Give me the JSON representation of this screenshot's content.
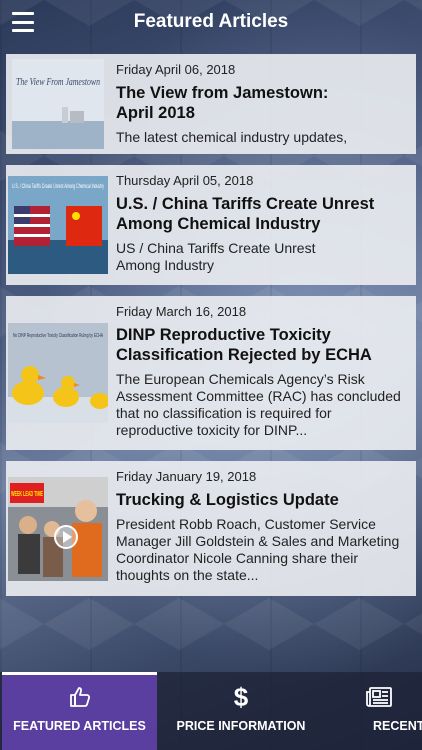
{
  "header": {
    "title": "Featured Articles",
    "menu_icon": "hamburger-menu-icon"
  },
  "articles": [
    {
      "date": "Friday April 06, 2018",
      "title": "The View from Jamestown: April 2018",
      "summary": "The latest chemical industry updates,",
      "thumb_text": "The View From Jamestown"
    },
    {
      "date": "Thursday April 05, 2018",
      "title": "U.S. / China Tariffs Create Unrest Among Chemical Industry",
      "summary": "US / China Tariffs Create Unrest Among Industry",
      "thumb_text": "U.S. / China Tariffs Create Unrest Among Chemical Industry"
    },
    {
      "date": "Friday March 16, 2018",
      "title": "DINP Reproductive Toxicity Classification Rejected by ECHA",
      "summary": "The European Chemicals Agency’s Risk Assessment Committee (RAC) has concluded that no classification is required for reproductive toxicity for DINP...",
      "thumb_text": "No DINP Reproductive Toxicity Classification Ruling by ECHA"
    },
    {
      "date": "Friday January 19, 2018",
      "title": "Trucking & Logistics Update",
      "summary": "President Robb Roach, Customer Service Manager Jill Goldstein & Sales and Marketing Coordinator Nicole Canning share their thoughts on the state...",
      "thumb_text": "WEEK LEAD TIME"
    }
  ],
  "tabs": [
    {
      "label": "FEATURED ARTICLES",
      "icon": "thumbs-up-icon",
      "active": true
    },
    {
      "label": "PRICE INFORMATION",
      "icon": "dollar-icon",
      "active": false
    },
    {
      "label": "RECENT",
      "icon": "newspaper-icon",
      "active": false
    }
  ],
  "colors": {
    "active_tab": "#5a3fa0",
    "tab_bar": "#1e2337"
  }
}
